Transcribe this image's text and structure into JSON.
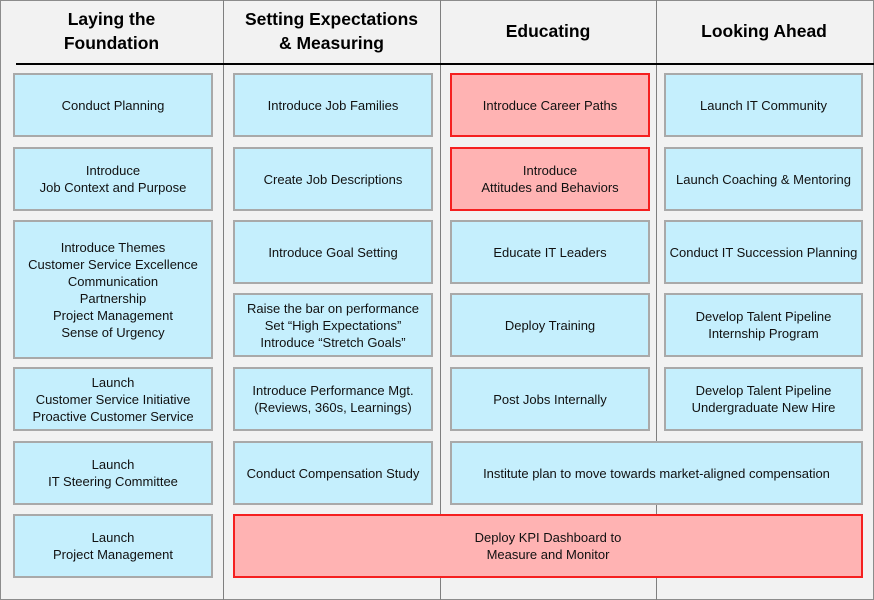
{
  "columns": [
    {
      "title": "Laying the\nFoundation",
      "items": [
        "Conduct Planning",
        "Introduce\nJob Context and Purpose",
        "Introduce Themes\nCustomer Service Excellence\nCommunication\nPartnership\nProject Management\nSense of Urgency",
        "Launch\nCustomer Service Initiative\nProactive Customer Service",
        "Launch\nIT Steering Committee",
        "Launch\nProject Management"
      ]
    },
    {
      "title": "Setting Expectations\n& Measuring",
      "items": [
        "Introduce Job Families",
        "Create Job Descriptions",
        "Introduce Goal Setting",
        "Raise the bar on performance\nSet “High Expectations”\nIntroduce “Stretch Goals”",
        "Introduce Performance Mgt.\n(Reviews, 360s, Learnings)",
        "Conduct Compensation Study"
      ]
    },
    {
      "title": "Educating",
      "items": [
        "Introduce Career Paths",
        "Introduce\nAttitudes and Behaviors",
        "Educate IT Leaders",
        "Deploy Training",
        "Post Jobs Internally"
      ]
    },
    {
      "title": "Looking Ahead",
      "items": [
        "Launch IT Community",
        "Launch Coaching & Mentoring",
        "Conduct IT Succession Planning",
        "Develop Talent Pipeline\nInternship  Program",
        "Develop Talent Pipeline\nUndergraduate New Hire"
      ]
    }
  ],
  "spanning": {
    "compensation_plan": "Institute plan to move towards market-aligned compensation",
    "kpi_dashboard": "Deploy KPI Dashboard  to\nMeasure and Monitor"
  },
  "highlighted": [
    "Introduce Career Paths",
    "Introduce Attitudes and Behaviors",
    "Deploy KPI Dashboard to Measure and Monitor"
  ],
  "colors": {
    "background": "#f2f2f2",
    "box_fill": "#c5effd",
    "box_border": "#a9a9a9",
    "highlight_fill": "#ffb3b3",
    "highlight_border": "#f52020"
  }
}
